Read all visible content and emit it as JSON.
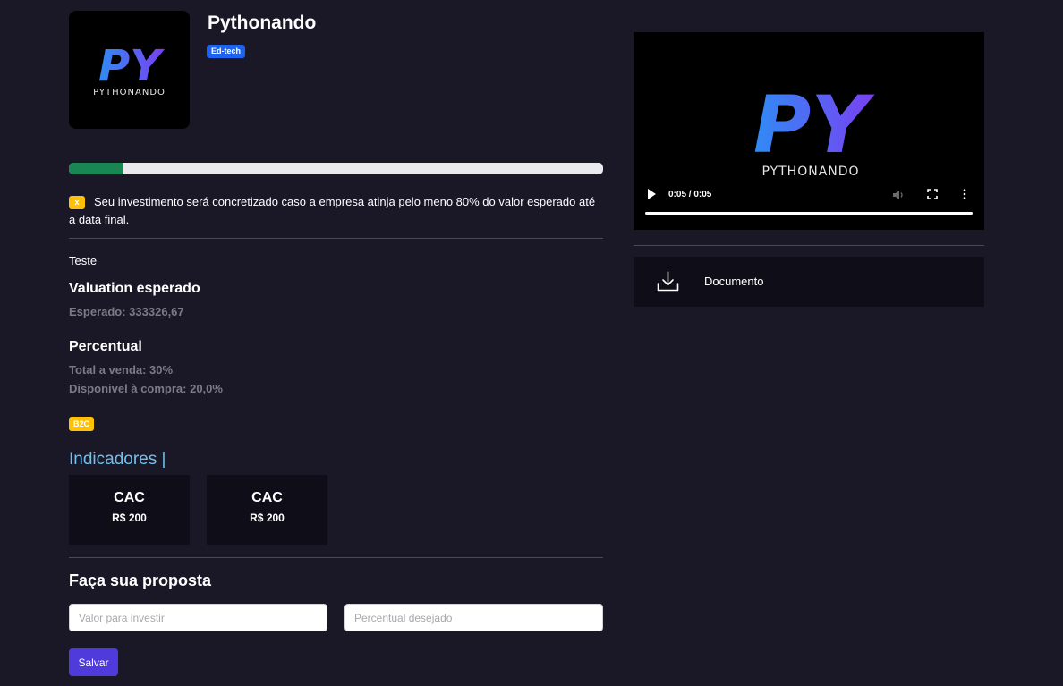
{
  "company": {
    "name": "Pythonando",
    "logo_text": "PYTHONANDO",
    "sector_badge": "Ed-tech"
  },
  "progress": {
    "percent": 10,
    "color": "#198754"
  },
  "notice": {
    "badge": "x",
    "text": "Seu investimento será concretizado caso a empresa atinja pelo meno 80% do valor esperado até a data final."
  },
  "description": "Teste",
  "valuation": {
    "title": "Valuation esperado",
    "expected": "Esperado: 333326,67"
  },
  "percentual": {
    "title": "Percentual",
    "total_sale": "Total a venda: 30%",
    "available": "Disponivel à compra: 20,0%"
  },
  "model_badge": "B2C",
  "indicators": {
    "title": "Indicadores |",
    "items": [
      {
        "label": "CAC",
        "value": "R$ 200"
      },
      {
        "label": "CAC",
        "value": "R$ 200"
      }
    ]
  },
  "proposal": {
    "title": "Faça sua proposta",
    "amount_placeholder": "Valor para investir",
    "percent_placeholder": "Percentual desejado",
    "save_label": "Salvar"
  },
  "video": {
    "logo_text": "PYTHONANDO",
    "time": "0:05 / 0:05",
    "progress_percent": 100
  },
  "document": {
    "label": "Documento",
    "icon": "download-icon"
  },
  "colors": {
    "background": "#1a1727",
    "accent": "#4f3bdb",
    "sector_badge": "#1d63ed",
    "warning": "#ffc107",
    "indicators_title": "#6ec1f0"
  }
}
